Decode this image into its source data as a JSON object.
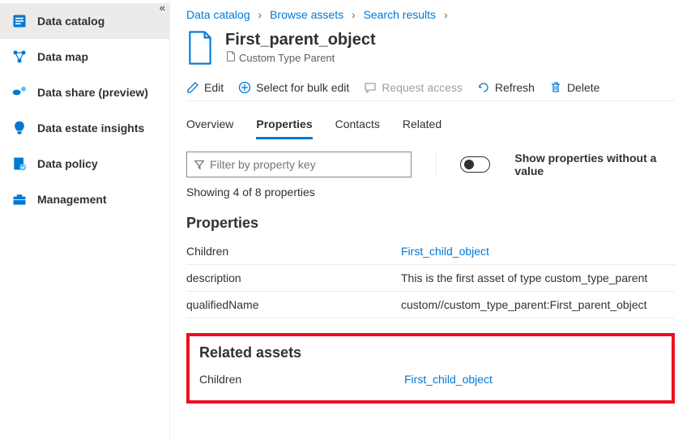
{
  "sidebar": {
    "items": [
      {
        "label": "Data catalog"
      },
      {
        "label": "Data map"
      },
      {
        "label": "Data share (preview)"
      },
      {
        "label": "Data estate insights"
      },
      {
        "label": "Data policy"
      },
      {
        "label": "Management"
      }
    ]
  },
  "breadcrumb": {
    "items": [
      "Data catalog",
      "Browse assets",
      "Search results"
    ]
  },
  "asset": {
    "title": "First_parent_object",
    "subtype": "Custom Type Parent"
  },
  "toolbar": {
    "edit": "Edit",
    "select_bulk": "Select for bulk edit",
    "request_access": "Request access",
    "refresh": "Refresh",
    "delete": "Delete"
  },
  "tabs": {
    "overview": "Overview",
    "properties": "Properties",
    "contacts": "Contacts",
    "related": "Related"
  },
  "filter": {
    "placeholder": "Filter by property key",
    "toggle_label": "Show properties without a value"
  },
  "showing": "Showing 4 of 8 properties",
  "sections": {
    "properties_title": "Properties",
    "related_title": "Related assets"
  },
  "properties": {
    "rows": [
      {
        "key": "Children",
        "value": "First_child_object",
        "link": true
      },
      {
        "key": "description",
        "value": "This is the first asset of type custom_type_parent",
        "link": false
      },
      {
        "key": "qualifiedName",
        "value": "custom//custom_type_parent:First_parent_object",
        "link": false
      }
    ]
  },
  "related": {
    "rows": [
      {
        "key": "Children",
        "value": "First_child_object"
      }
    ]
  }
}
